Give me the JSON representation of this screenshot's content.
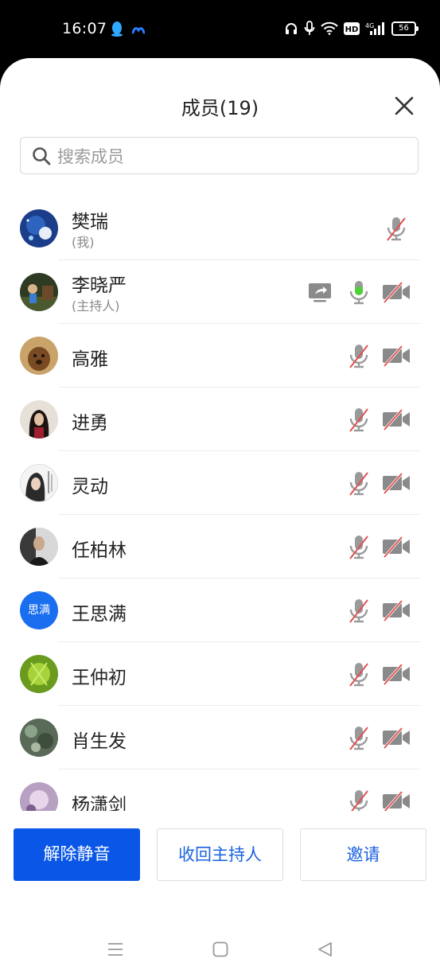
{
  "status_bar": {
    "time": "16:07",
    "left_icons": [
      "qq-penguin-icon",
      "app-wave-icon"
    ],
    "right_icons": [
      "headphones-icon",
      "microphone-icon",
      "wifi-icon",
      "hd-icon",
      "signal-4g-icon"
    ],
    "network_label": "4G",
    "hd_label": "HD",
    "battery_level": "56"
  },
  "header": {
    "title": "成员(19)",
    "close_icon": "close-icon"
  },
  "search": {
    "placeholder": "搜索成员",
    "value": ""
  },
  "members": [
    {
      "name": "樊瑞",
      "tag": "(我)",
      "avatar": "photo",
      "share": false,
      "mic": "muted",
      "camera": null
    },
    {
      "name": "李晓严",
      "tag": "(主持人)",
      "avatar": "photo",
      "share": true,
      "mic": "active",
      "camera": "off"
    },
    {
      "name": "高雅",
      "tag": "",
      "avatar": "photo",
      "share": false,
      "mic": "muted",
      "camera": "off"
    },
    {
      "name": "进勇",
      "tag": "",
      "avatar": "photo",
      "share": false,
      "mic": "muted",
      "camera": "off"
    },
    {
      "name": "灵动",
      "tag": "",
      "avatar": "photo",
      "share": false,
      "mic": "muted",
      "camera": "off"
    },
    {
      "name": "任柏林",
      "tag": "",
      "avatar": "photo",
      "share": false,
      "mic": "muted",
      "camera": "off"
    },
    {
      "name": "王思满",
      "tag": "",
      "avatar": "text",
      "avatar_text": "思满",
      "share": false,
      "mic": "muted",
      "camera": "off"
    },
    {
      "name": "王仲初",
      "tag": "",
      "avatar": "photo",
      "share": false,
      "mic": "muted",
      "camera": "off"
    },
    {
      "name": "肖生发",
      "tag": "",
      "avatar": "photo",
      "share": false,
      "mic": "muted",
      "camera": "off"
    },
    {
      "name": "杨潇剑",
      "tag": "",
      "avatar": "photo",
      "share": false,
      "mic": "muted",
      "camera": "off"
    }
  ],
  "buttons": {
    "unmute": "解除静音",
    "reclaim_host": "收回主持人",
    "invite": "邀请"
  },
  "nav_bar": {
    "items": [
      "menu-icon",
      "home-icon",
      "back-icon"
    ]
  },
  "colors": {
    "primary": "#0a56e6",
    "link_blue": "#1a62e0",
    "mic_active": "#4cd137",
    "mute_slash": "#e05050"
  }
}
